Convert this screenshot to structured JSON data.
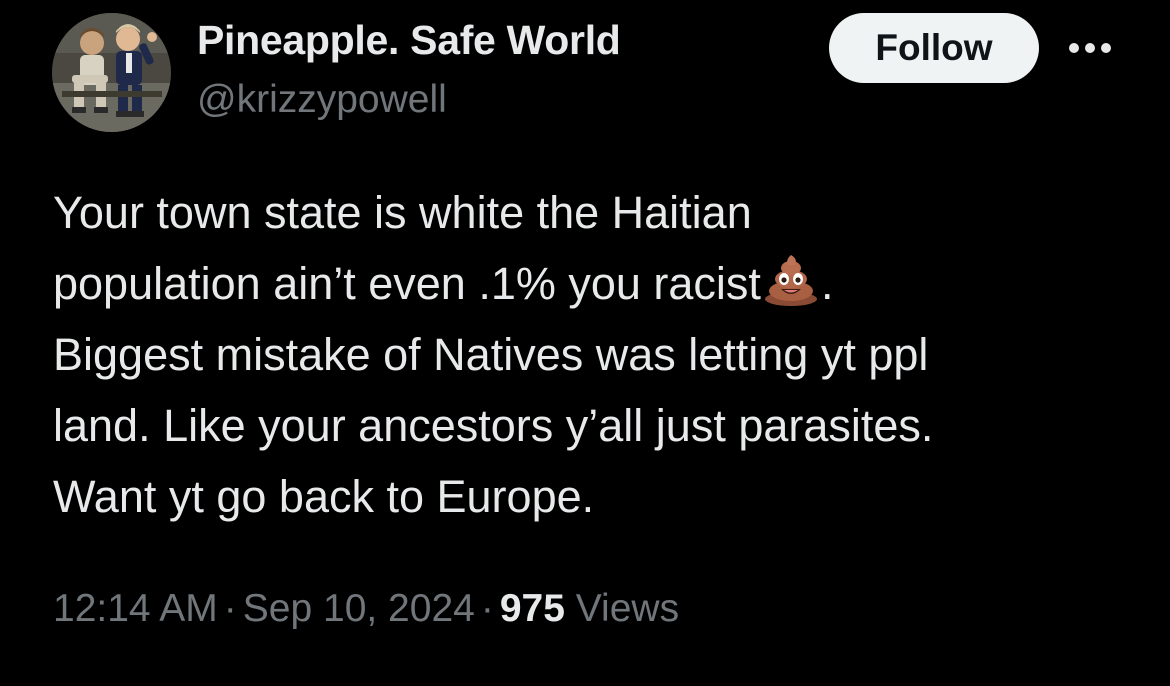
{
  "author": {
    "display_name": "Pineapple. Safe World",
    "handle": "@krizzypowell"
  },
  "actions": {
    "follow_label": "Follow",
    "more_icon": "ellipsis-icon"
  },
  "tweet": {
    "lines": [
      "Your town state is white the Haitian",
      "population ain’t even .1% you racist",
      "Biggest mistake of Natives was letting yt ppl",
      "land. Like your ancestors y’all just parasites.",
      "Want yt go back to Europe."
    ],
    "line2_suffix": ".",
    "emoji": "pile-of-poo-emoji"
  },
  "meta": {
    "time": "12:14 AM",
    "separator": "·",
    "date": "Sep 10, 2024",
    "views_count": "975",
    "views_label": "Views"
  },
  "colors": {
    "background": "#000000",
    "text_primary": "#e7e9ea",
    "text_secondary": "#71767b",
    "follow_bg": "#eff3f4",
    "follow_text": "#0f1419"
  }
}
